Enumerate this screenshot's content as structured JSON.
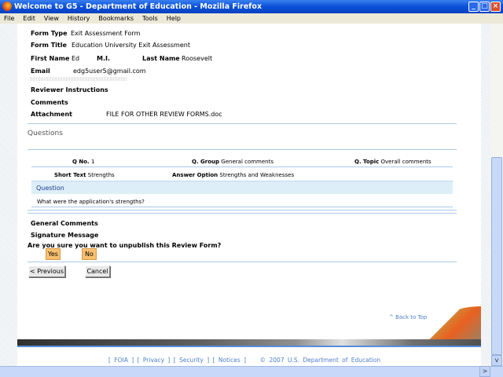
{
  "window": {
    "title": "Welcome to G5 - Department of Education - Mozilla Firefox"
  },
  "menu": [
    "File",
    "Edit",
    "View",
    "History",
    "Bookmarks",
    "Tools",
    "Help"
  ],
  "form": {
    "form_type_label": "Form Type",
    "form_type": "Exit Assessment Form",
    "form_title_label": "Form Title",
    "form_title": "Education University Exit Assessment",
    "first_name_label": "First Name",
    "first_name": "Ed",
    "mi_label": "M.I.",
    "last_name_label": "Last Name",
    "last_name": "Roosevelt",
    "email_label": "Email",
    "email": "edg5user5@gmail.com",
    "reviewer_instructions_label": "Reviewer Instructions",
    "comments_label": "Comments",
    "attachment_label": "Attachment",
    "attachment": "FILE FOR OTHER REVIEW FORMS.doc"
  },
  "questions": {
    "heading": "Questions",
    "qno_label": "Q No.",
    "qno": "1",
    "group_label": "Q. Group",
    "group": "General comments",
    "topic_label": "Q. Topic",
    "topic": "Overall comments",
    "short_text_label": "Short Text",
    "short_text": "Strengths",
    "answer_option_label": "Answer Option",
    "answer_option": "Strengths and Weaknesses",
    "question_label": "Question",
    "question_text": "What were the application's strengths?"
  },
  "general_comments_label": "General Comments",
  "signature_message_label": "Signature Message",
  "confirm": {
    "prompt": "Are you sure you want to unpublish this Review Form?",
    "yes": "Yes",
    "no": "No"
  },
  "nav": {
    "previous": "< Previous",
    "cancel": "Cancel"
  },
  "back_to_top": "^ Back to Top",
  "footer": {
    "links": [
      "FOIA",
      "Privacy",
      "Security",
      "Notices"
    ],
    "copyright": "© 2007 U.S. Department of Education"
  },
  "colors": {
    "accent_line": "#a8c8e8",
    "button_orange": "#f8c070",
    "question_band": "#ddeef8",
    "title_blue": "#0a50d8"
  }
}
